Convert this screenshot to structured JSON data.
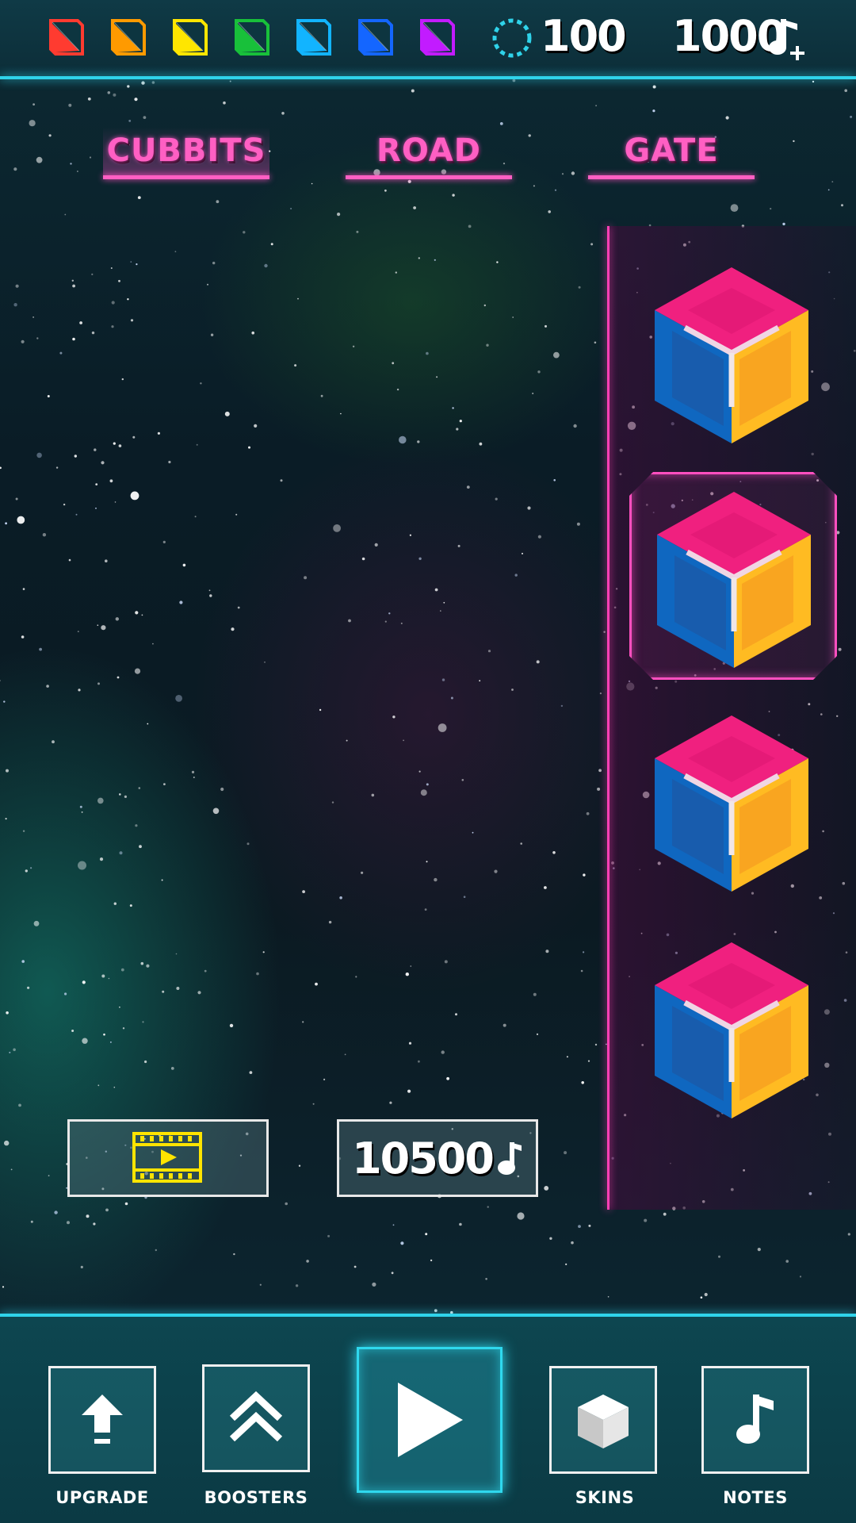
{
  "top_bar": {
    "gems": [
      {
        "color": "#ff3b30"
      },
      {
        "color": "#ff9a00"
      },
      {
        "color": "#ffe600"
      },
      {
        "color": "#18c03a"
      },
      {
        "color": "#12b4ff"
      },
      {
        "color": "#1466ff"
      },
      {
        "color": "#c21bff"
      }
    ],
    "rings_count": "100",
    "notes_count": "1000"
  },
  "tabs": [
    {
      "label": "CUBBITS",
      "active": true
    },
    {
      "label": "ROAD",
      "active": false
    },
    {
      "label": "GATE",
      "active": false
    }
  ],
  "skins": [
    {
      "selected": false
    },
    {
      "selected": true
    },
    {
      "selected": false
    },
    {
      "selected": false
    }
  ],
  "actions": {
    "buy_price": "10500"
  },
  "bottom_nav": {
    "upgrade_label": "UPGRADE",
    "boosters_label": "BOOSTERS",
    "skins_label": "SKINS",
    "notes_label": "NOTES"
  },
  "colors": {
    "accent_cyan": "#2fd3ea",
    "accent_pink": "#ff4fbf",
    "cube_top": "#f0207f",
    "cube_left": "#0f67c0",
    "cube_right": "#ffbb22"
  }
}
